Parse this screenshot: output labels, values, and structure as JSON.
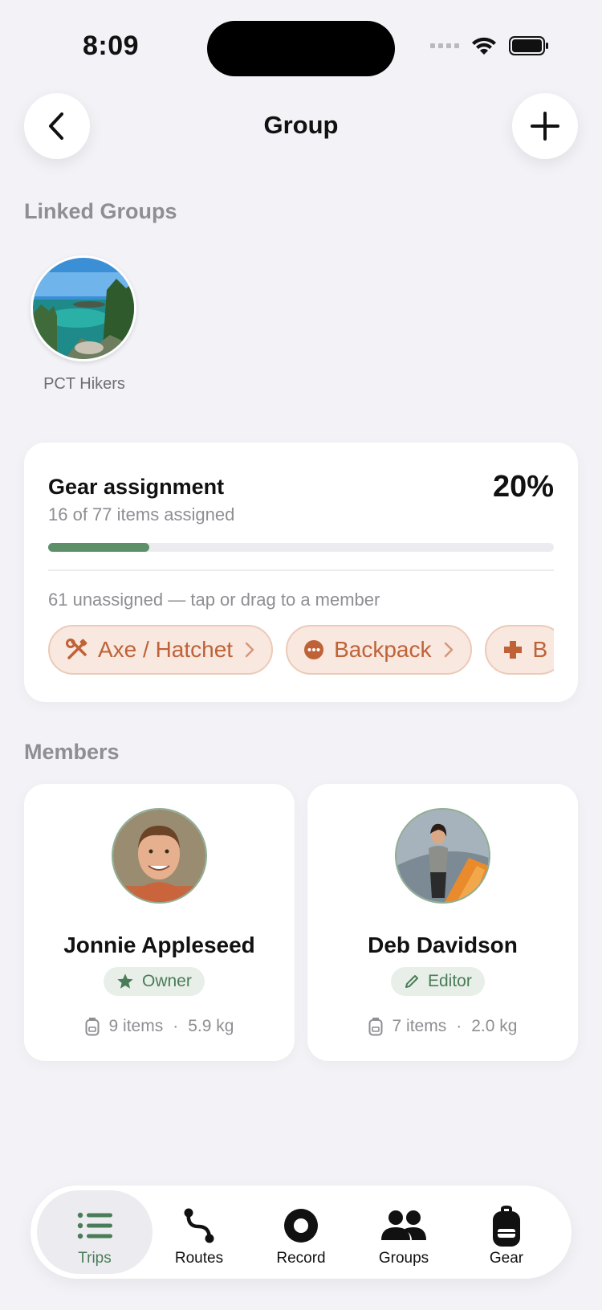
{
  "status_bar": {
    "time": "8:09"
  },
  "header": {
    "title": "Group"
  },
  "linked_groups": {
    "heading": "Linked Groups",
    "groups": [
      {
        "name": "PCT Hikers"
      }
    ]
  },
  "gear_assignment": {
    "title": "Gear assignment",
    "subtitle": "16 of 77 items assigned",
    "percent_label": "20%",
    "progress": 0.2,
    "unassigned_text": "61 unassigned — tap or drag to a member",
    "chips": [
      {
        "label": "Axe / Hatchet",
        "icon": "tools-icon"
      },
      {
        "label": "Backpack",
        "icon": "dots-circle-icon"
      },
      {
        "label": "B",
        "icon": "medical-cross-icon"
      }
    ]
  },
  "members": {
    "heading": "Members",
    "list": [
      {
        "name": "Jonnie Appleseed",
        "role": "Owner",
        "role_icon": "star-icon",
        "items": "9 items",
        "weight": "5.9 kg"
      },
      {
        "name": "Deb Davidson",
        "role": "Editor",
        "role_icon": "pencil-icon",
        "items": "7 items",
        "weight": "2.0 kg"
      }
    ],
    "separator": "·"
  },
  "tab_bar": {
    "active": "Trips",
    "tabs": [
      {
        "label": "Trips",
        "icon": "list-icon"
      },
      {
        "label": "Routes",
        "icon": "route-icon"
      },
      {
        "label": "Record",
        "icon": "record-icon"
      },
      {
        "label": "Groups",
        "icon": "people-icon"
      },
      {
        "label": "Gear",
        "icon": "backpack-icon"
      }
    ]
  },
  "colors": {
    "accent_green": "#4a7c57",
    "progress_green": "#5d8f69",
    "chip_orange": "#bf6237",
    "chip_bg": "#f8e8df",
    "background": "#f2f2f7"
  }
}
